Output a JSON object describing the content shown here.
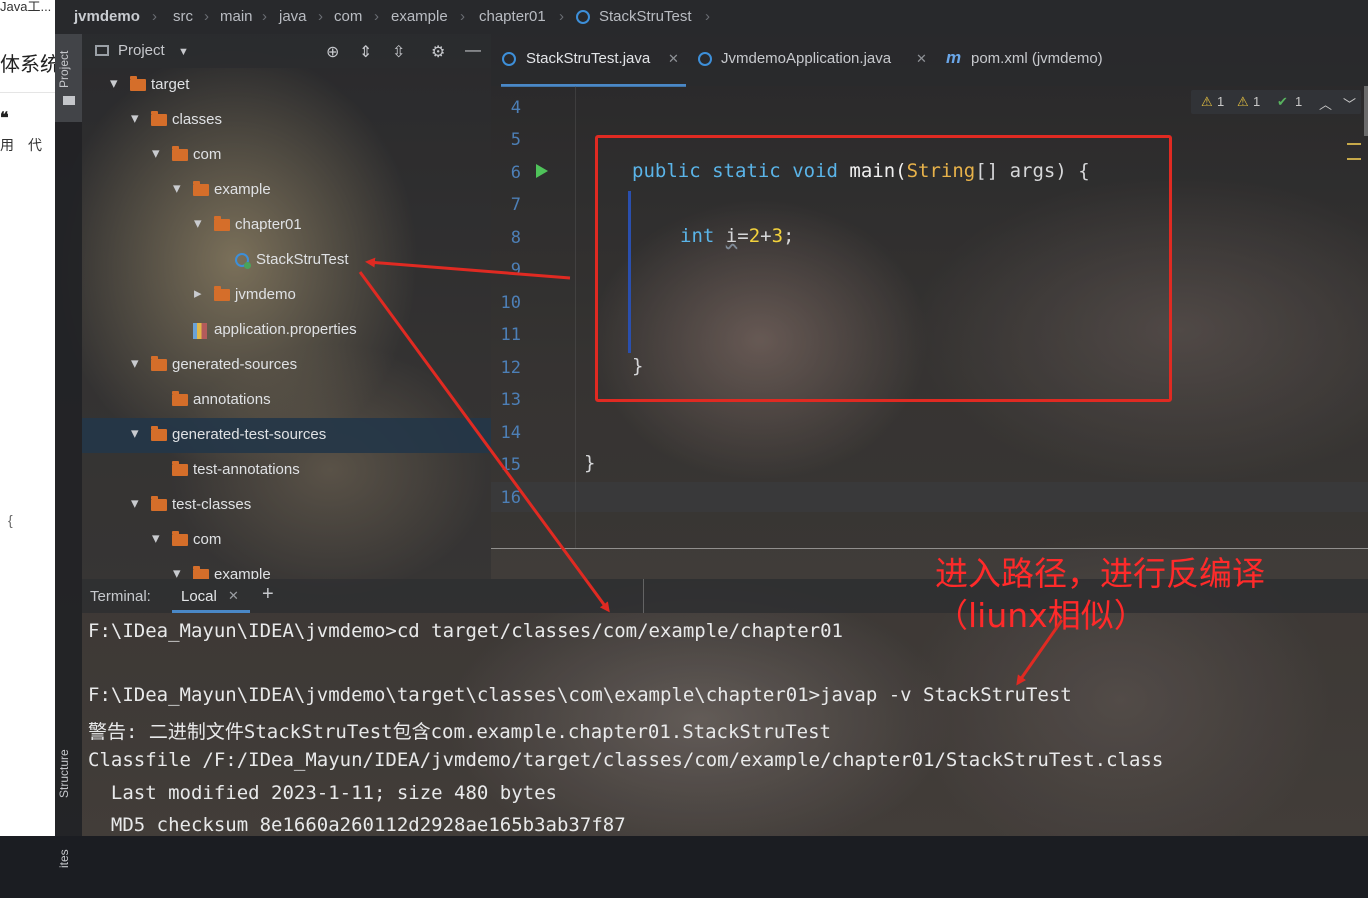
{
  "browser": {
    "tab_fragment": "Java工...",
    "heading_fragment": "体系统",
    "quote_mark": "❝",
    "line_fragment": "用　代",
    "brace": "{"
  },
  "breadcrumb": [
    "jvmdemo",
    "src",
    "main",
    "java",
    "com",
    "example",
    "chapter01",
    "StackStruTest"
  ],
  "side_tabs": {
    "project": "Project",
    "structure": "Structure",
    "favorites": "ites"
  },
  "project_panel": {
    "title": "Project",
    "tree": [
      {
        "label": "target",
        "depth": 0,
        "type": "folder",
        "expanded": true
      },
      {
        "label": "classes",
        "depth": 1,
        "type": "folder",
        "expanded": true
      },
      {
        "label": "com",
        "depth": 2,
        "type": "folder",
        "expanded": true
      },
      {
        "label": "example",
        "depth": 3,
        "type": "folder",
        "expanded": true
      },
      {
        "label": "chapter01",
        "depth": 4,
        "type": "folder",
        "expanded": true
      },
      {
        "label": "StackStruTest",
        "depth": 5,
        "type": "class"
      },
      {
        "label": "jvmdemo",
        "depth": 4,
        "type": "folder",
        "expanded": false
      },
      {
        "label": "application.properties",
        "depth": 3,
        "type": "properties"
      },
      {
        "label": "generated-sources",
        "depth": 1,
        "type": "folder",
        "expanded": true
      },
      {
        "label": "annotations",
        "depth": 2,
        "type": "folder"
      },
      {
        "label": "generated-test-sources",
        "depth": 1,
        "type": "folder",
        "expanded": true,
        "selected": true
      },
      {
        "label": "test-annotations",
        "depth": 2,
        "type": "folder"
      },
      {
        "label": "test-classes",
        "depth": 1,
        "type": "folder",
        "expanded": true
      },
      {
        "label": "com",
        "depth": 2,
        "type": "folder",
        "expanded": true
      },
      {
        "label": "example",
        "depth": 3,
        "type": "folder",
        "expanded": true
      }
    ]
  },
  "editor_tabs": [
    {
      "label": "StackStruTest.java",
      "active": true,
      "icon": "class-icon"
    },
    {
      "label": "JvmdemoApplication.java",
      "active": false,
      "icon": "class-icon"
    },
    {
      "label": "pom.xml (jvmdemo)",
      "active": false,
      "icon": "maven-icon"
    }
  ],
  "inspections": {
    "warnings_a": "1",
    "warnings_b": "1",
    "ok": "1"
  },
  "editor": {
    "line_numbers": [
      "4",
      "5",
      "6",
      "7",
      "8",
      "9",
      "10",
      "11",
      "12",
      "13",
      "14",
      "15",
      "16"
    ],
    "code": {
      "main_kw1": "public",
      "main_kw2": "static",
      "main_kw3": "void",
      "main_name": "main(",
      "main_type": "String",
      "main_rest": "[] args) {",
      "int_kw": "int",
      "int_var": "i",
      "int_eq": "=",
      "int_n1": "2",
      "int_plus": "+",
      "int_n2": "3",
      "int_semi": ";",
      "close_inner": "}",
      "close_outer": "}"
    }
  },
  "annotation": {
    "text": "进入路径，进行反编译（liunx相似）"
  },
  "terminal": {
    "label": "Terminal:",
    "tab": "Local",
    "lines": [
      "F:\\IDea_Mayun\\IDEA\\jvmdemo>cd target/classes/com/example/chapter01",
      "F:\\IDea_Mayun\\IDEA\\jvmdemo\\target\\classes\\com\\example\\chapter01>javap -v StackStruTest",
      "警告: 二进制文件StackStruTest包含com.example.chapter01.StackStruTest",
      "Classfile /F:/IDea_Mayun/IDEA/jvmdemo/target/classes/com/example/chapter01/StackStruTest.class",
      "  Last modified 2023-1-11; size 480 bytes",
      "  MD5 checksum 8e1660a260112d2928ae165b3ab37f87"
    ]
  },
  "colors": {
    "annotation_red": "#e02a22",
    "keyword_blue": "#5ab4e8",
    "type_orange": "#e8b24a",
    "number_yellow": "#f3d23c"
  }
}
